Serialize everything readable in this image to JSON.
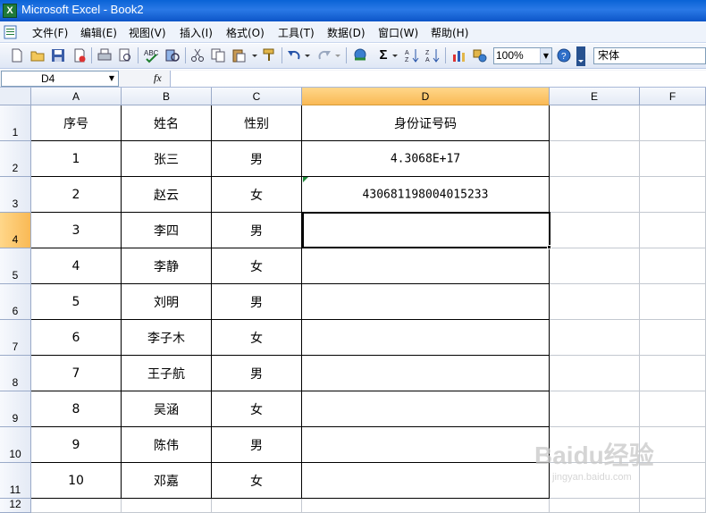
{
  "window": {
    "title": "Microsoft Excel - Book2",
    "app_icon": "X"
  },
  "menu": [
    "文件(F)",
    "编辑(E)",
    "视图(V)",
    "插入(I)",
    "格式(O)",
    "工具(T)",
    "数据(D)",
    "窗口(W)",
    "帮助(H)"
  ],
  "toolbar": {
    "zoom": "100%",
    "font": "宋体",
    "sum_symbol": "Σ",
    "icons": [
      "new-icon",
      "open-icon",
      "save-icon",
      "permission-icon",
      "print-icon",
      "print-preview-icon",
      "spelling-icon",
      "research-icon",
      "cut-icon",
      "copy-icon",
      "paste-icon",
      "format-painter-icon",
      "undo-icon",
      "redo-icon",
      "hyperlink-icon",
      "autosum-icon",
      "sort-ascending-icon",
      "sort-descending-icon",
      "chart-wizard-icon",
      "drawing-icon",
      "help-icon"
    ]
  },
  "formula_bar": {
    "name_box": "D4",
    "fx": "fx",
    "formula": ""
  },
  "grid": {
    "columns": [
      "A",
      "B",
      "C",
      "D",
      "E",
      "F"
    ],
    "active_column": "D",
    "active_row": "4",
    "header_row": {
      "row": "1",
      "cells": [
        "序号",
        "姓名",
        "性别",
        "身份证号码"
      ]
    },
    "rows": [
      {
        "row": "2",
        "cells": [
          "1",
          "张三",
          "男",
          "4.3068E+17"
        ]
      },
      {
        "row": "3",
        "cells": [
          "2",
          "赵云",
          "女",
          "430681198004015233"
        ]
      },
      {
        "row": "4",
        "cells": [
          "3",
          "李四",
          "男",
          ""
        ]
      },
      {
        "row": "5",
        "cells": [
          "4",
          "李静",
          "女",
          ""
        ]
      },
      {
        "row": "6",
        "cells": [
          "5",
          "刘明",
          "男",
          ""
        ]
      },
      {
        "row": "7",
        "cells": [
          "6",
          "李子木",
          "女",
          ""
        ]
      },
      {
        "row": "8",
        "cells": [
          "7",
          "王子航",
          "男",
          ""
        ]
      },
      {
        "row": "9",
        "cells": [
          "8",
          "吴涵",
          "女",
          ""
        ]
      },
      {
        "row": "10",
        "cells": [
          "9",
          "陈伟",
          "男",
          ""
        ]
      },
      {
        "row": "11",
        "cells": [
          "10",
          "邓嘉",
          "女",
          ""
        ]
      }
    ],
    "extra_row": "12"
  },
  "watermark": {
    "text": "Baidu经验",
    "subtext": "jingyan.baidu.com"
  },
  "colors": {
    "title_bar": "#0a63d6",
    "active_header": "#f9b955",
    "error_marker": "#1f8a3b"
  }
}
